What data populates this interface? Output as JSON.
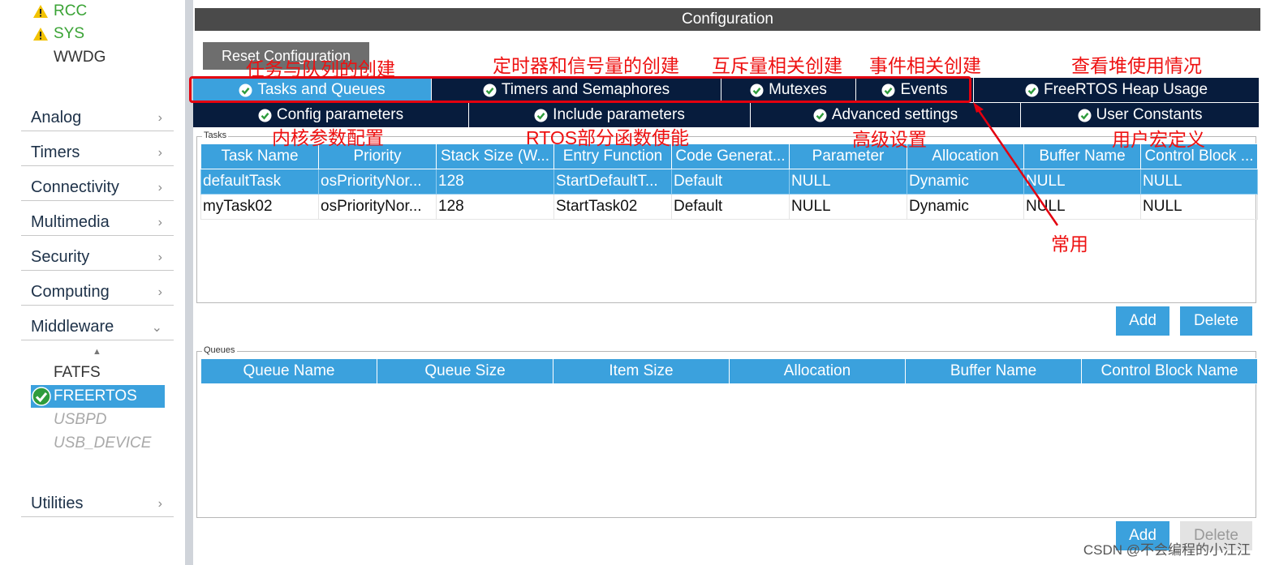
{
  "sidebar": {
    "peripherals": [
      {
        "label": "RCC",
        "warning": true
      },
      {
        "label": "SYS",
        "warning": true
      },
      {
        "label": "WWDG",
        "warning": false
      }
    ],
    "categories": [
      "Analog",
      "Timers",
      "Connectivity",
      "Multimedia",
      "Security",
      "Computing",
      "Middleware"
    ],
    "middleware_items": [
      {
        "label": "FATFS",
        "state": "normal"
      },
      {
        "label": "FREERTOS",
        "state": "selected"
      },
      {
        "label": "USBPD",
        "state": "disabled"
      },
      {
        "label": "USB_DEVICE",
        "state": "disabled"
      }
    ],
    "utilities": "Utilities"
  },
  "main": {
    "title": "Configuration",
    "reset_label": "Reset Configuration",
    "tabs_row1": [
      "Tasks and Queues",
      "Timers and Semaphores",
      "Mutexes",
      "Events",
      "FreeRTOS Heap Usage"
    ],
    "tabs_row2": [
      "Config parameters",
      "Include parameters",
      "Advanced settings",
      "User Constants"
    ],
    "tasks": {
      "group_label": "Tasks",
      "columns": [
        "Task Name",
        "Priority",
        "Stack Size (W...",
        "Entry Function",
        "Code Generat...",
        "Parameter",
        "Allocation",
        "Buffer Name",
        "Control Block ..."
      ],
      "rows": [
        [
          "defaultTask",
          "osPriorityNor...",
          "128",
          "StartDefaultT...",
          "Default",
          "NULL",
          "Dynamic",
          "NULL",
          "NULL"
        ],
        [
          "myTask02",
          "osPriorityNor...",
          "128",
          "StartTask02",
          "Default",
          "NULL",
          "Dynamic",
          "NULL",
          "NULL"
        ]
      ],
      "add_label": "Add",
      "delete_label": "Delete"
    },
    "queues": {
      "group_label": "Queues",
      "columns": [
        "Queue Name",
        "Queue Size",
        "Item Size",
        "Allocation",
        "Buffer Name",
        "Control Block Name"
      ],
      "add_label": "Add",
      "delete_label": "Delete"
    }
  },
  "annotations": {
    "tasks_queues": "任务与队列的创建",
    "timers_semaphores": "定时器和信号量的创建",
    "mutexes": "互斥量相关创建",
    "events": "事件相关创建",
    "heap_usage": "查看堆使用情况",
    "config_params": "内核参数配置",
    "include_params": "RTOS部分函数使能",
    "advanced": "高级设置",
    "user_constants": "用户宏定义",
    "common": "常用"
  },
  "watermark": "CSDN @不会编程的小江江",
  "colors": {
    "accent": "#3ba1dd",
    "tab_dark": "#071c3d",
    "annotation": "#ee1111",
    "warning": "#f2c200",
    "ok": "#3aa335"
  }
}
